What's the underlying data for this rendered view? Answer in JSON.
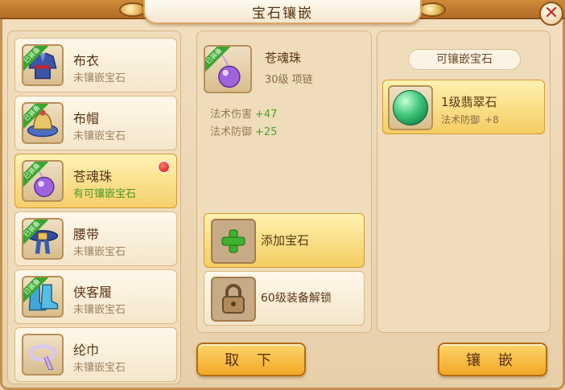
{
  "window": {
    "title": "宝石镶嵌",
    "close_icon": "close-x-icon"
  },
  "equipment_list": [
    {
      "name": "布衣",
      "status": "未镶嵌宝石",
      "equipped_badge": "已装备",
      "icon": "robe-icon",
      "active": false
    },
    {
      "name": "布帽",
      "status": "未镶嵌宝石",
      "equipped_badge": "已装备",
      "icon": "hat-icon",
      "active": false
    },
    {
      "name": "苍魂珠",
      "status": "有可镶嵌宝石",
      "equipped_badge": "已装备",
      "icon": "orb-icon",
      "active": true,
      "notify": true
    },
    {
      "name": "腰带",
      "status": "未镶嵌宝石",
      "equipped_badge": "已装备",
      "icon": "belt-icon",
      "active": false
    },
    {
      "name": "侠客履",
      "status": "未镶嵌宝石",
      "equipped_badge": "已装备",
      "icon": "boots-icon",
      "active": false
    },
    {
      "name": "纶巾",
      "status": "未镶嵌宝石",
      "equipped_badge": "",
      "icon": "scarf-icon",
      "active": false
    }
  ],
  "selected_item": {
    "name": "苍魂珠",
    "level_type": "30级  项链",
    "equipped_badge": "已装备",
    "stats": [
      {
        "label": "法术伤害",
        "value": "+47"
      },
      {
        "label": "法术防御",
        "value": "+25"
      }
    ],
    "add_gem_label": "添加宝石",
    "locked_slot_label": "60级装备解锁"
  },
  "available_gems": {
    "header": "可镶嵌宝石",
    "gems": [
      {
        "name": "1级翡翠石",
        "stat_label": "法术防御",
        "stat_value": "+8",
        "icon": "emerald-gem-icon"
      }
    ]
  },
  "buttons": {
    "remove_label": "取 下",
    "inlay_label": "镶 嵌"
  },
  "colors": {
    "accent_gold": "#f5cd62",
    "bonus_green": "#4aa22a",
    "notify_red": "#d50f0f",
    "badge_green": "#39a72e"
  }
}
